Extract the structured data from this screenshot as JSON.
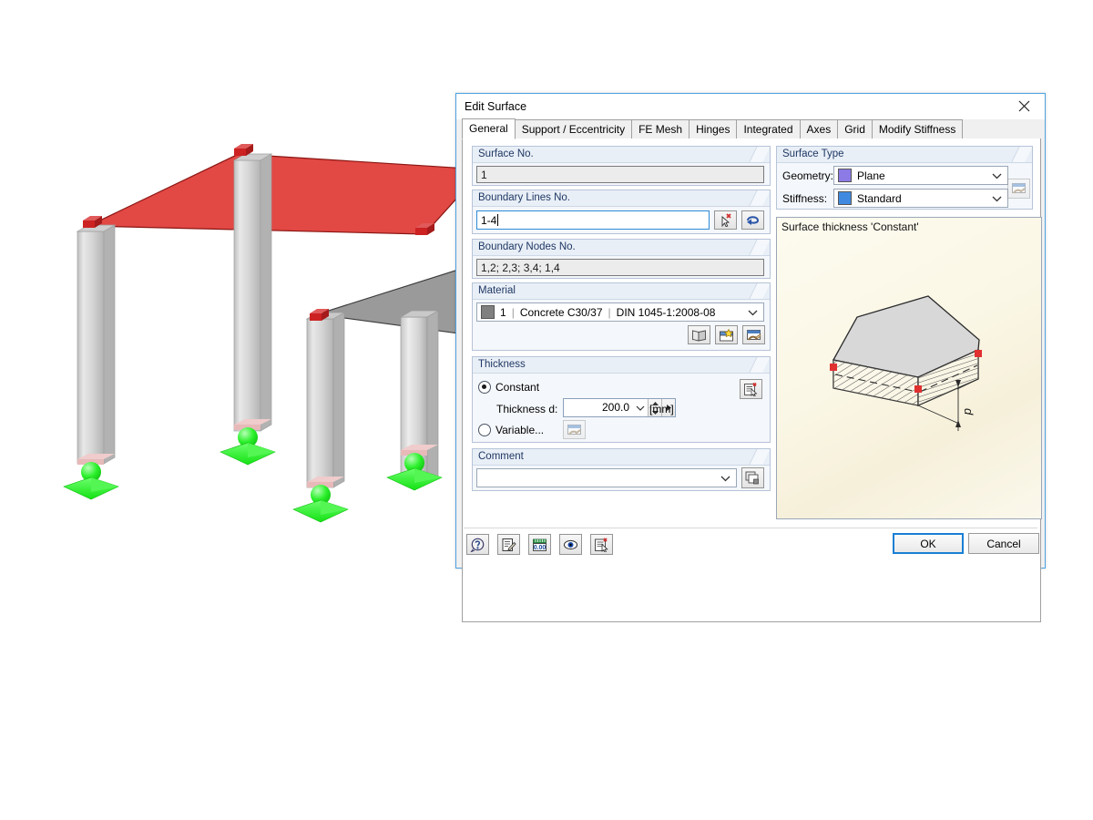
{
  "window": {
    "title": "Edit Surface",
    "close_icon": "close-icon"
  },
  "tabs": [
    {
      "label": "General",
      "active": true
    },
    {
      "label": "Support / Eccentricity",
      "active": false
    },
    {
      "label": "FE Mesh",
      "active": false
    },
    {
      "label": "Hinges",
      "active": false
    },
    {
      "label": "Integrated",
      "active": false
    },
    {
      "label": "Axes",
      "active": false
    },
    {
      "label": "Grid",
      "active": false
    },
    {
      "label": "Modify Stiffness",
      "active": false
    }
  ],
  "general": {
    "surface_no": {
      "legend": "Surface No.",
      "value": "1"
    },
    "boundary_lines": {
      "legend": "Boundary Lines No.",
      "value": "1-4",
      "pick_button_icon": "pick-lines-icon",
      "reverse_button_icon": "reverse-orientation-icon"
    },
    "boundary_nodes": {
      "legend": "Boundary Nodes No.",
      "value": "1,2; 2,3; 3,4; 1,4"
    },
    "material": {
      "legend": "Material",
      "color": "#808080",
      "number": "1",
      "name": "Concrete C30/37",
      "standard": "DIN 1045-1:2008-08",
      "buttons": [
        {
          "icon": "material-library-icon"
        },
        {
          "icon": "new-material-icon"
        },
        {
          "icon": "edit-material-icon"
        }
      ]
    },
    "thickness": {
      "legend": "Thickness",
      "constant_label": "Constant",
      "constant_selected": true,
      "thickness_label": "Thickness d:",
      "thickness_value": "200.0",
      "thickness_unit": "[mm]",
      "variable_label": "Variable...",
      "variable_selected": false,
      "variable_button_icon": "edit-variable-thickness-icon",
      "info_button_icon": "thickness-info-icon"
    },
    "comment": {
      "legend": "Comment",
      "value": "",
      "button_icon": "comment-list-icon"
    }
  },
  "surface_type": {
    "legend": "Surface Type",
    "geometry_label": "Geometry:",
    "geometry_value": "Plane",
    "geometry_color": "#8c7ae6",
    "stiffness_label": "Stiffness:",
    "stiffness_value": "Standard",
    "stiffness_color": "#3f8ae0",
    "stiffness_edit_icon": "edit-stiffness-icon"
  },
  "preview": {
    "caption": "Surface thickness 'Constant'",
    "dimension_label": "d",
    "node_color": "#e03030",
    "plate_top_color": "#d8d8d8"
  },
  "toolbar": [
    {
      "icon": "help-icon",
      "name": "help-button"
    },
    {
      "icon": "notes-icon",
      "name": "notes-button"
    },
    {
      "icon": "units-icon",
      "name": "units-button"
    },
    {
      "icon": "view-mode-icon",
      "name": "view-mode-button"
    },
    {
      "icon": "details-icon",
      "name": "details-button"
    }
  ],
  "footer": {
    "ok_label": "OK",
    "cancel_label": "Cancel"
  },
  "model": {
    "surface_selected_color": "#e03a36",
    "surface_other_color": "#8c8c8c",
    "column_color": "#d4d4d4",
    "support_color": "#33ff33",
    "node_color": "#cc2222"
  }
}
